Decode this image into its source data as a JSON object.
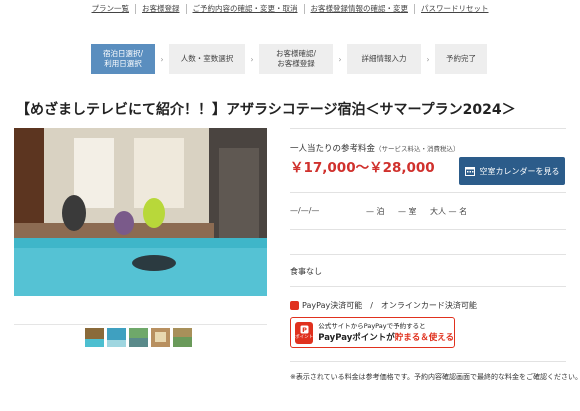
{
  "top_nav": [
    "プラン一覧",
    "お客様登録",
    "ご予約内容の確認・変更・取消",
    "お客様登録情報の確認・変更",
    "パスワードリセット"
  ],
  "steps": [
    {
      "label": "宿泊日選択/\n利用日選択",
      "active": true
    },
    {
      "label": "人数・室数選択",
      "active": false
    },
    {
      "label": "お客様確認/\nお客様登録",
      "active": false
    },
    {
      "label": "詳細情報入力",
      "active": false
    },
    {
      "label": "予約完了",
      "active": false
    }
  ],
  "plan_title": "【めざましテレビにて紹介！！】アザラシコテージ宿泊＜サマープラン2024＞",
  "price": {
    "label": "一人当たりの参考料金",
    "note": "（サービス料込・消費税込）",
    "range": "￥17,000〜￥28,000"
  },
  "calendar_button": "空室カレンダーを見る",
  "selection": {
    "date": "—/—/—",
    "nights": "— 泊",
    "rooms": "— 室",
    "adults": "大人 — 名"
  },
  "meal": "食事なし",
  "payment": {
    "methods": "PayPay決済可能　/　オンラインカード決済可能",
    "banner_line1": "公式サイトからPayPayで予約すると",
    "banner_line2_a": "PayPayポイントが",
    "banner_line2_b": "貯まる＆使える",
    "logo_text": "ポイント"
  },
  "disclaimer": "※表示されている料金は参考価格です。予約内容確認画面で最終的な料金をご確認ください。",
  "colors": {
    "accent": "#5a8ebf",
    "price": "#d0312d",
    "button": "#2c5c8a",
    "paypay": "#e0311e"
  }
}
